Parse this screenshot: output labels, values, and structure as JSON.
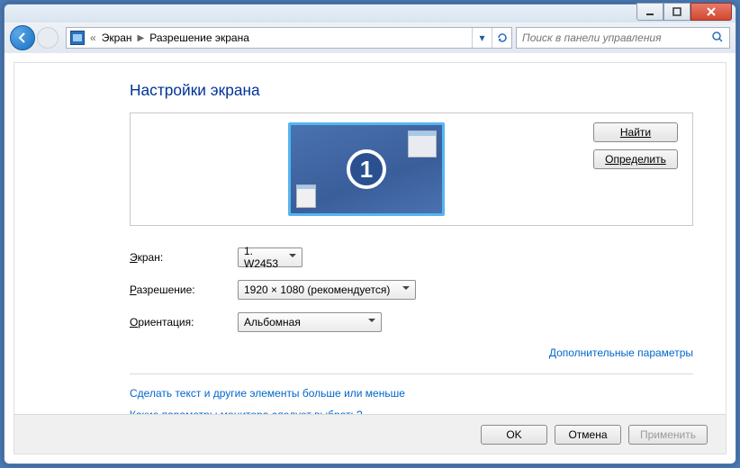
{
  "breadcrumb": {
    "item1": "Экран",
    "item2": "Разрешение экрана"
  },
  "search": {
    "placeholder": "Поиск в панели управления"
  },
  "title": "Настройки экрана",
  "monitor_number": "1",
  "buttons": {
    "find": "Найти",
    "detect": "Определить",
    "ok": "OK",
    "cancel": "Отмена",
    "apply": "Применить"
  },
  "labels": {
    "screen_pre": "Э",
    "screen_rest": "кран:",
    "resolution_pre": "Р",
    "resolution_rest": "азрешение:",
    "orientation_pre": "О",
    "orientation_rest": "риентация:"
  },
  "values": {
    "screen": "1. W2453",
    "resolution": "1920 × 1080 (рекомендуется)",
    "orientation": "Альбомная"
  },
  "links": {
    "advanced": "Дополнительные параметры",
    "help1": "Сделать текст и другие элементы больше или меньше",
    "help2": "Какие параметры монитора следует выбрать?"
  }
}
